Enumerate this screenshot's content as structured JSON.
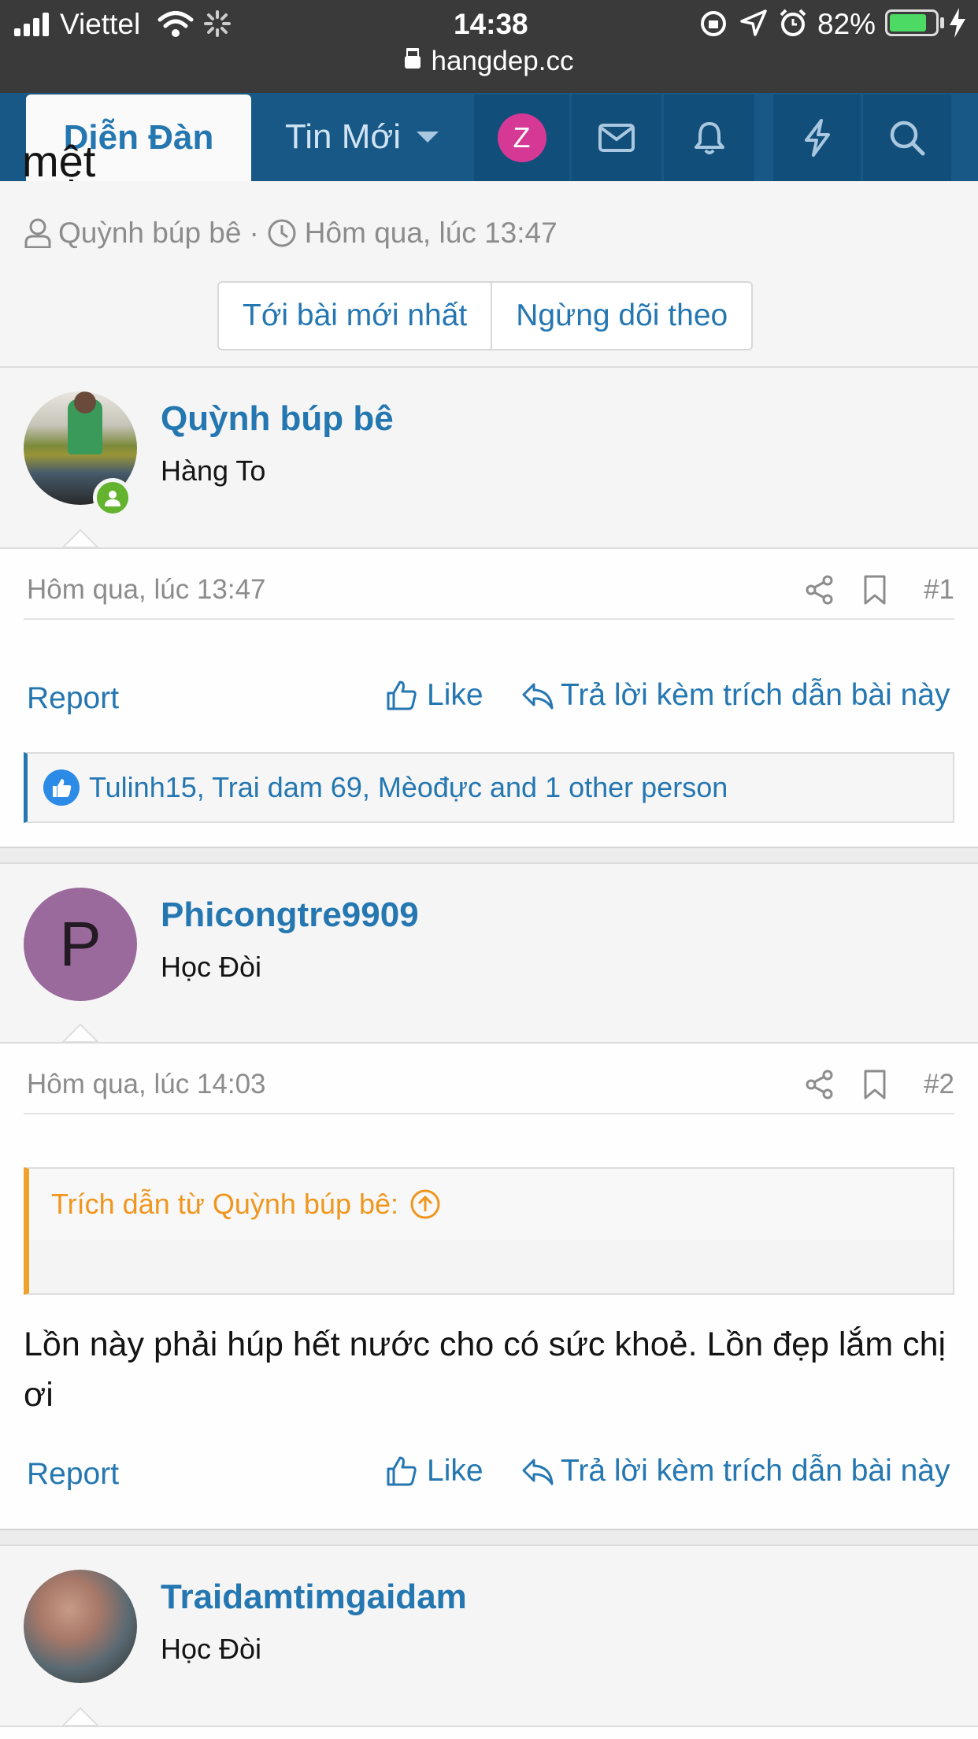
{
  "status_bar": {
    "carrier": "Viettel",
    "time": "14:38",
    "battery": "82%",
    "url": "hangdep.cc"
  },
  "nav": {
    "tab_forums": "Diễn Đàn",
    "tab_whats_new": "Tin Mới",
    "avatar_letter": "Z"
  },
  "thread": {
    "title_fragment": "mệt",
    "author": "Quỳnh búp bê",
    "separator": "·",
    "date": "Hôm qua, lúc 13:47",
    "btn_latest": "Tới bài mới nhất",
    "btn_unwatch": "Ngừng dõi theo"
  },
  "posts": [
    {
      "username": "Quỳnh búp bê",
      "user_title": "Hàng To",
      "date": "Hôm qua, lúc 13:47",
      "number": "#1",
      "report": "Report",
      "like": "Like",
      "reply": "Trả lời kèm trích dẫn bài này",
      "likes_text": "Tulinh15, Trai dam 69, Mèođực and 1 other person"
    },
    {
      "username": "Phicongtre9909",
      "user_title": "Học Đòi",
      "avatar_letter": "P",
      "date": "Hôm qua, lúc 14:03",
      "number": "#2",
      "quote_header": "Trích dẫn từ Quỳnh búp bê:",
      "message": "Lồn này phải húp hết nước cho có sức khoẻ. Lồn đẹp lắm chị ơi",
      "report": "Report",
      "like": "Like",
      "reply": "Trả lời kèm trích dẫn bài này"
    },
    {
      "username": "Traidamtimgaidam",
      "user_title": "Học Đòi"
    }
  ],
  "colors": {
    "nav_bg": "#185886",
    "link": "#2577b1",
    "quote_accent": "#f0a12b",
    "avatar_p": "#9b6a9c",
    "avatar_z": "#d63896"
  }
}
